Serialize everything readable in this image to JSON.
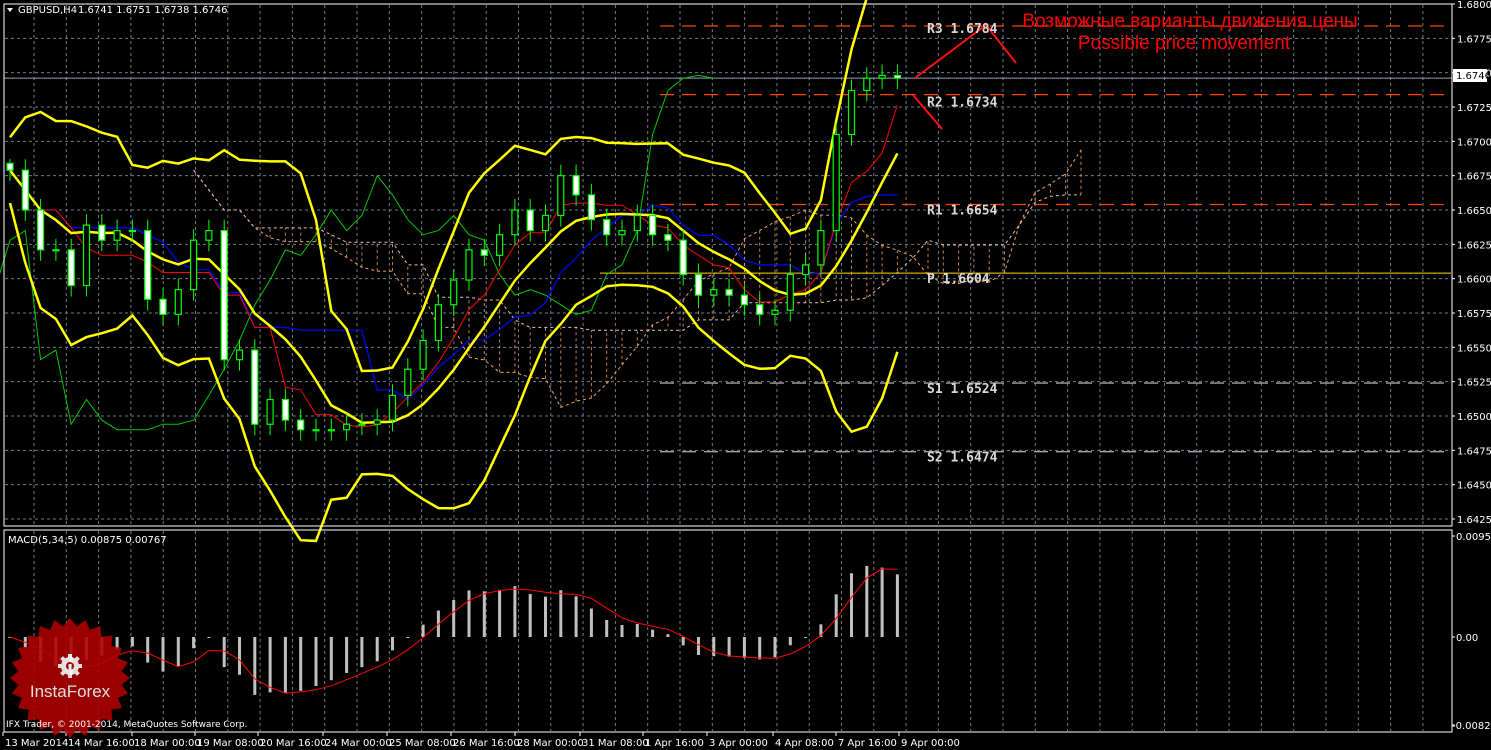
{
  "header": {
    "symbol_label": "GBPUSD,H4",
    "ohlc": "1.6741 1.6751 1.6738 1.6746",
    "menu_icon": "triangle-down-icon"
  },
  "annotation": {
    "line1": "Возможные варианты движения цены",
    "line2": "Possible price movement",
    "color": "#ff0000"
  },
  "pivots": [
    {
      "label": "R3",
      "value": 1.6784,
      "text": "R3 1.6784",
      "color": "#ff4500"
    },
    {
      "label": "R2",
      "value": 1.6734,
      "text": "R2 1.6734",
      "color": "#ff4500"
    },
    {
      "label": "R1",
      "value": 1.6654,
      "text": "R1 1.6654",
      "color": "#ff4500"
    },
    {
      "label": "P",
      "value": 1.6604,
      "text": "P 1.6604",
      "color": "#ffd700"
    },
    {
      "label": "S1",
      "value": 1.6524,
      "text": "S1 1.6524",
      "color": "#a0a0a0"
    },
    {
      "label": "S2",
      "value": 1.6474,
      "text": "S2 1.6474",
      "color": "#a0a0a0"
    }
  ],
  "macd": {
    "label": "MACD(5,34,5) 0.00875 0.00767",
    "axis_labels": [
      "0.00956",
      "0.00",
      "-0.00821"
    ]
  },
  "footer": {
    "copyright": "IFX Trader, © 2001-2014, MetaQuotes Software Corp.",
    "logo_text": "InstaForex"
  },
  "chart_data": {
    "type": "candlestick",
    "symbol": "GBPUSD",
    "timeframe": "H4",
    "ylim": [
      1.6425,
      1.68
    ],
    "y_ticks": [
      "1.6800",
      "1.6775",
      "1.6750",
      "1.6725",
      "1.6700",
      "1.6675",
      "1.6650",
      "1.6625",
      "1.6600",
      "1.6575",
      "1.6550",
      "1.6525",
      "1.6500",
      "1.6475",
      "1.6450",
      "1.6425"
    ],
    "current_price": "1.6746",
    "x_ticks": [
      "13 Mar 2014",
      "14 Mar 16:00",
      "18 Mar 00:00",
      "19 Mar 08:00",
      "20 Mar 16:00",
      "24 Mar 00:00",
      "25 Mar 08:00",
      "26 Mar 16:00",
      "28 Mar 00:00",
      "31 Mar 08:00",
      "1 Apr 16:00",
      "3 Apr 00:00",
      "4 Apr 08:00",
      "7 Apr 16:00",
      "9 Apr 00:00"
    ],
    "closes": [
      1.6679,
      1.665,
      1.6621,
      1.6621,
      1.6595,
      1.6639,
      1.6628,
      1.6635,
      1.6635,
      1.6585,
      1.6574,
      1.6592,
      1.6628,
      1.6635,
      1.6541,
      1.6548,
      1.6494,
      1.6512,
      1.6497,
      1.649,
      1.649,
      1.649,
      1.6494,
      1.6494,
      1.6497,
      1.6515,
      1.6534,
      1.6555,
      1.6581,
      1.6599,
      1.6621,
      1.6617,
      1.6632,
      1.665,
      1.6635,
      1.6646,
      1.6675,
      1.6661,
      1.6643,
      1.6632,
      1.6635,
      1.6646,
      1.6632,
      1.6628,
      1.6603,
      1.6588,
      1.6592,
      1.6588,
      1.6581,
      1.6574,
      1.6577,
      1.6603,
      1.661,
      1.6635,
      1.6705,
      1.6737,
      1.6746,
      1.6748,
      1.6746
    ],
    "indicators": [
      "Bollinger Bands",
      "Ichimoku Kinko Hyo",
      "MACD(5,34,5)",
      "Pivot Points"
    ],
    "macd_ylim": [
      -0.00821,
      0.00956
    ],
    "colors": {
      "background": "#000000",
      "grid": "#6e7b8b",
      "candle_outline": "#00ff00",
      "bear_body": "#ffffff",
      "bull_body": "#000000",
      "bollinger": "#ffff00",
      "tenkan": "#ff0000",
      "kijun": "#0000ff",
      "chikou": "#00c800",
      "cloud": "#f4a460",
      "macd_hist": "#c0c0c0",
      "macd_signal": "#ff0000",
      "axis": "#ffffff"
    }
  }
}
